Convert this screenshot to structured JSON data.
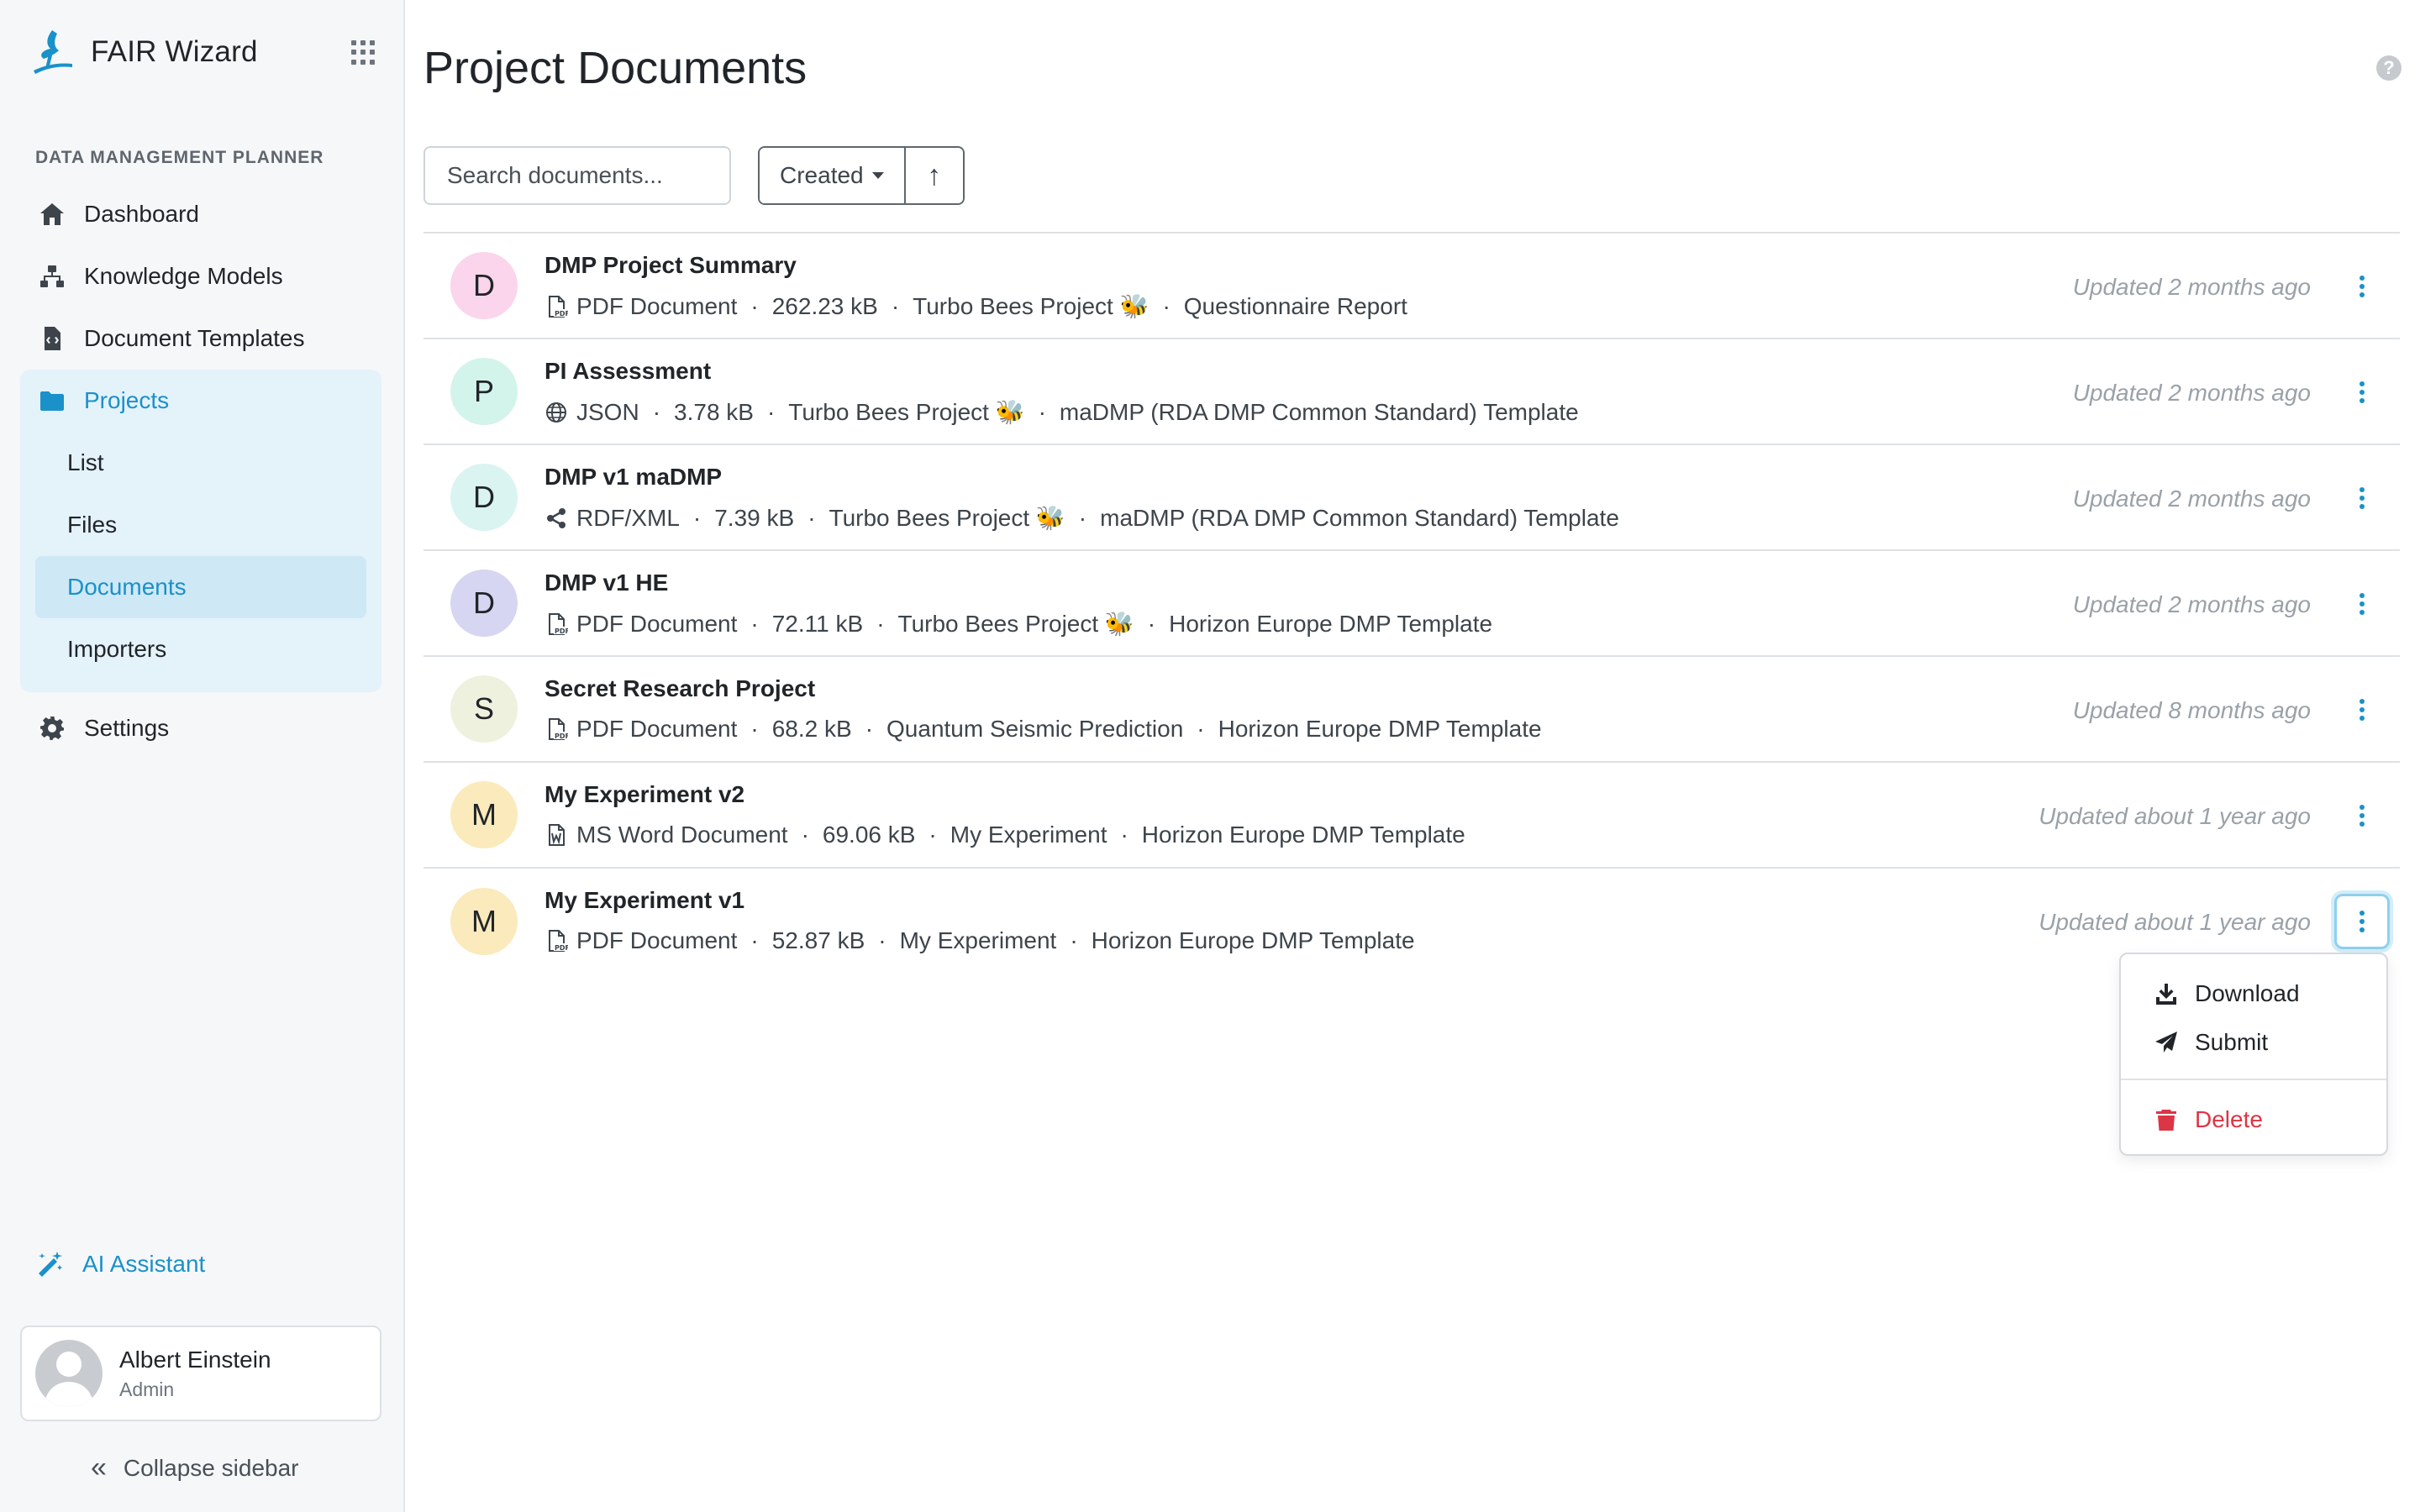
{
  "brand": {
    "name": "FAIR Wizard"
  },
  "sidebar": {
    "section_label": "DATA MANAGEMENT PLANNER",
    "items": [
      {
        "label": "Dashboard",
        "icon": "home-icon"
      },
      {
        "label": "Knowledge Models",
        "icon": "sitemap-icon"
      },
      {
        "label": "Document Templates",
        "icon": "file-code-icon"
      },
      {
        "label": "Projects",
        "icon": "folder-icon"
      },
      {
        "label": "Settings",
        "icon": "gear-icon"
      }
    ],
    "projects_sub": [
      {
        "label": "List"
      },
      {
        "label": "Files"
      },
      {
        "label": "Documents"
      },
      {
        "label": "Importers"
      }
    ],
    "ai_assistant": "AI Assistant",
    "user": {
      "name": "Albert Einstein",
      "role": "Admin"
    },
    "collapse_label": "Collapse sidebar"
  },
  "main": {
    "title": "Project Documents",
    "search_placeholder": "Search documents...",
    "sort_label": "Created",
    "sort_direction": "↑",
    "documents": [
      {
        "initial": "D",
        "avatar_color": "#fbd5ec",
        "name": "DMP Project Summary",
        "format": "PDF Document",
        "format_icon": "pdf-file-icon",
        "size": "262.23 kB",
        "project": "Turbo Bees Project 🐝",
        "template": "Questionnaire Report",
        "updated": "Updated 2 months ago"
      },
      {
        "initial": "P",
        "avatar_color": "#d3f4ea",
        "name": "PI Assessment",
        "format": "JSON",
        "format_icon": "globe-icon",
        "size": "3.78 kB",
        "project": "Turbo Bees Project 🐝",
        "template": "maDMP (RDA DMP Common Standard) Template",
        "updated": "Updated 2 months ago"
      },
      {
        "initial": "D",
        "avatar_color": "#d9f4f1",
        "name": "DMP v1 maDMP",
        "format": "RDF/XML",
        "format_icon": "share-nodes-icon",
        "size": "7.39 kB",
        "project": "Turbo Bees Project 🐝",
        "template": "maDMP (RDA DMP Common Standard) Template",
        "updated": "Updated 2 months ago"
      },
      {
        "initial": "D",
        "avatar_color": "#d6d6f3",
        "name": "DMP v1 HE",
        "format": "PDF Document",
        "format_icon": "pdf-file-icon",
        "size": "72.11 kB",
        "project": "Turbo Bees Project 🐝",
        "template": "Horizon Europe DMP Template",
        "updated": "Updated 2 months ago"
      },
      {
        "initial": "S",
        "avatar_color": "#eef1dd",
        "name": "Secret Research Project",
        "format": "PDF Document",
        "format_icon": "pdf-file-icon",
        "size": "68.2 kB",
        "project": "Quantum Seismic Prediction",
        "template": "Horizon Europe DMP Template",
        "updated": "Updated 8 months ago"
      },
      {
        "initial": "M",
        "avatar_color": "#fbeabc",
        "name": "My Experiment v2",
        "format": "MS Word Document",
        "format_icon": "word-file-icon",
        "size": "69.06 kB",
        "project": "My Experiment",
        "template": "Horizon Europe DMP Template",
        "updated": "Updated about 1 year ago"
      },
      {
        "initial": "M",
        "avatar_color": "#fbeabc",
        "name": "My Experiment v1",
        "format": "PDF Document",
        "format_icon": "pdf-file-icon",
        "size": "52.87 kB",
        "project": "My Experiment",
        "template": "Horizon Europe DMP Template",
        "updated": "Updated about 1 year ago"
      }
    ],
    "dropdown": {
      "download": "Download",
      "submit": "Submit",
      "delete": "Delete"
    }
  },
  "colors": {
    "accent": "#1a91c9",
    "danger": "#dc3545",
    "muted": "#9aa1a8"
  }
}
